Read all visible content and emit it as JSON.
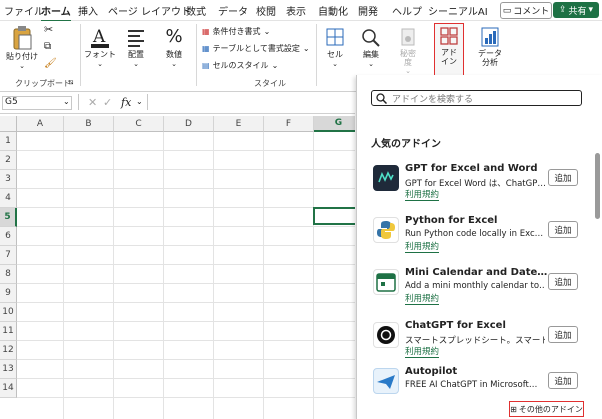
{
  "menubar": {
    "tabs": [
      "ファイル",
      "ホーム",
      "挿入",
      "ページ レイアウト",
      "数式",
      "データ",
      "校閲",
      "表示",
      "自動化",
      "開発",
      "ヘルプ",
      "シーニアルAI"
    ],
    "comment": "コメント",
    "share": "共有"
  },
  "ribbon": {
    "paste": "貼り付け",
    "clipboard": "クリップボード",
    "font": "フォント",
    "align": "配置",
    "number": "数値",
    "conditional": "条件付き書式",
    "table_format": "テーブルとして書式設定",
    "cell_style": "セルのスタイル",
    "style_group": "スタイル",
    "cells": "セル",
    "editing": "編集",
    "sensitivity": "秘密\n度",
    "addin": "アド\nイン",
    "data_analysis": "データ\n分析"
  },
  "formula": {
    "namebox": "G5",
    "fx": "fx"
  },
  "grid": {
    "columns": [
      "A",
      "B",
      "C",
      "D",
      "E",
      "F",
      "G"
    ],
    "rows": [
      "1",
      "2",
      "3",
      "4",
      "5",
      "6",
      "7",
      "8",
      "9",
      "10",
      "11",
      "12",
      "13",
      "14"
    ]
  },
  "pane": {
    "search_placeholder": "アドインを検索する",
    "popular_title": "人気のアドイン",
    "addins": [
      {
        "name": "GPT for Excel and Word",
        "desc": "GPT for Excel Word は、ChatGP…",
        "terms": "利用規約",
        "btn": "追加"
      },
      {
        "name": "Python for Excel",
        "desc": "Run Python code locally in Exc…",
        "terms": "利用規約",
        "btn": "追加"
      },
      {
        "name": "Mini Calendar and Date…",
        "desc": "Add a mini monthly calendar to…",
        "terms": "利用規約",
        "btn": "追加"
      },
      {
        "name": "ChatGPT for Excel",
        "desc": "スマートスプレッドシート。スマートな決断。",
        "terms": "利用規約",
        "btn": "追加"
      },
      {
        "name": "Autopilot",
        "desc": "FREE AI ChatGPT in Microsoft…",
        "terms": "",
        "btn": "追加"
      }
    ],
    "more_addins": "その他のアドイン"
  },
  "colors": {
    "accent": "#1e7145",
    "highlight": "#e03030"
  }
}
